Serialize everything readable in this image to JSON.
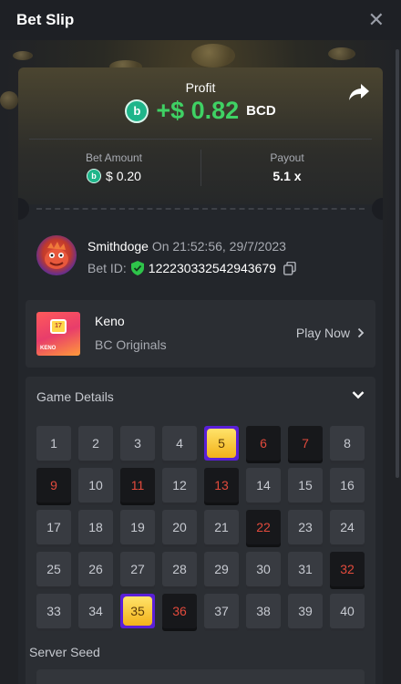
{
  "header": {
    "title": "Bet Slip",
    "close_glyph": "✕"
  },
  "profit": {
    "label": "Profit",
    "value": "+$ 0.82",
    "unit": "BCD",
    "coin_icon": "bc-coin-icon",
    "value_color": "#3fd164"
  },
  "stats": {
    "bet_amount_label": "Bet Amount",
    "bet_amount": "$ 0.20",
    "payout_label": "Payout",
    "payout": "5.1 x"
  },
  "bet": {
    "username": "Smithdoge",
    "time": "On 21:52:56, 29/7/2023",
    "bet_id_label": "Bet ID:",
    "bet_id": "122230332542943679"
  },
  "game": {
    "name": "Keno",
    "provider": "BC Originals",
    "play_label": "Play Now",
    "thumb_number": "17",
    "thumb_text": "KENO"
  },
  "details": {
    "title": "Game Details",
    "numbers": [
      "1",
      "2",
      "3",
      "4",
      "5",
      "6",
      "7",
      "8",
      "9",
      "10",
      "11",
      "12",
      "13",
      "14",
      "15",
      "16",
      "17",
      "18",
      "19",
      "20",
      "21",
      "22",
      "23",
      "24",
      "25",
      "26",
      "27",
      "28",
      "29",
      "30",
      "31",
      "32",
      "33",
      "34",
      "35",
      "36",
      "37",
      "38",
      "39",
      "40"
    ],
    "hits": [
      "5",
      "35"
    ],
    "picked_misses": [
      "6",
      "7",
      "9",
      "11",
      "13",
      "22",
      "32",
      "36"
    ],
    "server_seed_label": "Server Seed"
  },
  "colors": {
    "accent_purple": "#5a1fd8",
    "miss_red": "#e24a3c",
    "hit_gold": "#f3b21a"
  }
}
